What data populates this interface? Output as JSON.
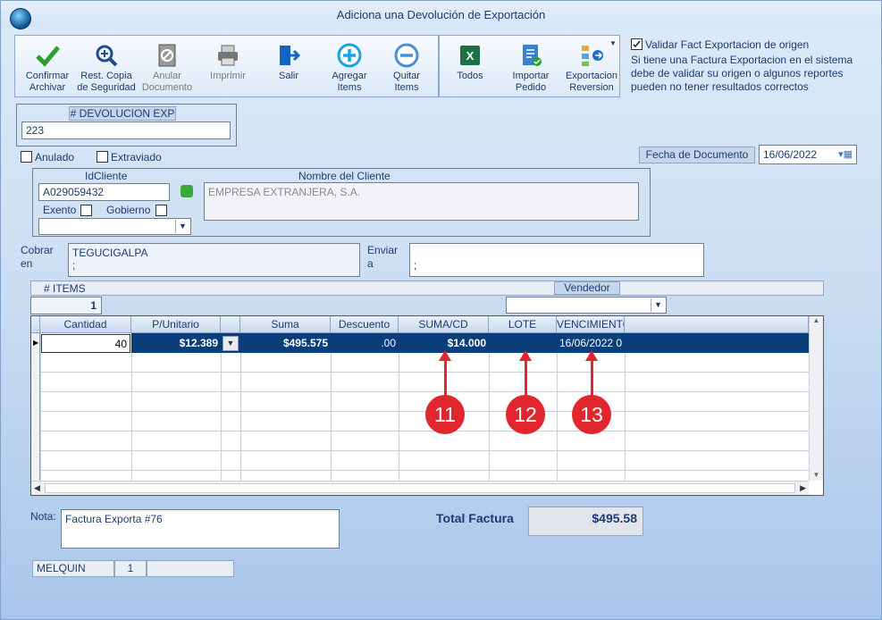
{
  "window": {
    "title": "Adiciona una Devolución de Exportación"
  },
  "toolbar": {
    "confirm": "Confirmar\nArchivar",
    "restore": "Rest. Copia\nde Seguridad",
    "void": "Anular\nDocumento",
    "print": "Imprimir",
    "exit": "Salir",
    "add_items": "Agregar\nItems",
    "remove_items": "Quitar\nItems",
    "all": "Todos",
    "import_order": "Importar\nPedido",
    "export_reversal": "Exportacion\nReversion"
  },
  "validate": {
    "label": "Validar Fact Exportacion de origen",
    "note": "Si tiene una Factura Exportacion en el sistema debe de validar su origen o algunos reportes pueden no tener resultados correctos",
    "checked": true
  },
  "doc": {
    "header": "# DEVOLUCION EXP",
    "number": "223"
  },
  "flags": {
    "anulado": "Anulado",
    "extraviado": "Extraviado"
  },
  "date": {
    "label": "Fecha de  Documento",
    "value": "16/06/2022"
  },
  "client": {
    "id_label": "IdCliente",
    "id_value": "A029059432",
    "name_label": "Nombre del Cliente",
    "name_value": "EMPRESA EXTRANJERA, S.A.",
    "exento": "Exento",
    "gobierno": "Gobierno"
  },
  "billing": {
    "cobrar_label": "Cobrar\nen",
    "cobrar_value": "TEGUCIGALPA\n ;",
    "enviar_label": "Enviar\na",
    "enviar_value": " ;"
  },
  "items_bar": {
    "label": "# ITEMS",
    "count": "1",
    "vendedor": "Vendedor"
  },
  "grid": {
    "columns": [
      "Cantidad",
      "P/Unitario",
      "",
      "Suma",
      "Descuento",
      "SUMA/CD",
      "LOTE",
      "VENCIMIENTO"
    ],
    "row": {
      "cantidad": "40",
      "unitario": "$12.389",
      "suma": "$495.575",
      "descuento": ".00",
      "sumacd": "$14.000",
      "lote": "",
      "vencimiento": "16/06/2022 0"
    }
  },
  "callouts": [
    "11",
    "12",
    "13"
  ],
  "nota": {
    "label": "Nota:",
    "value": "Factura Exporta #76"
  },
  "total": {
    "label": "Total Factura",
    "value": "$495.58"
  },
  "footer": {
    "user": "MELQUIN",
    "num": "1",
    "extra": ""
  },
  "colors": {
    "accent": "#0a3e7a",
    "row_selected": "#0a3e7a",
    "callout": "#e2262e"
  }
}
